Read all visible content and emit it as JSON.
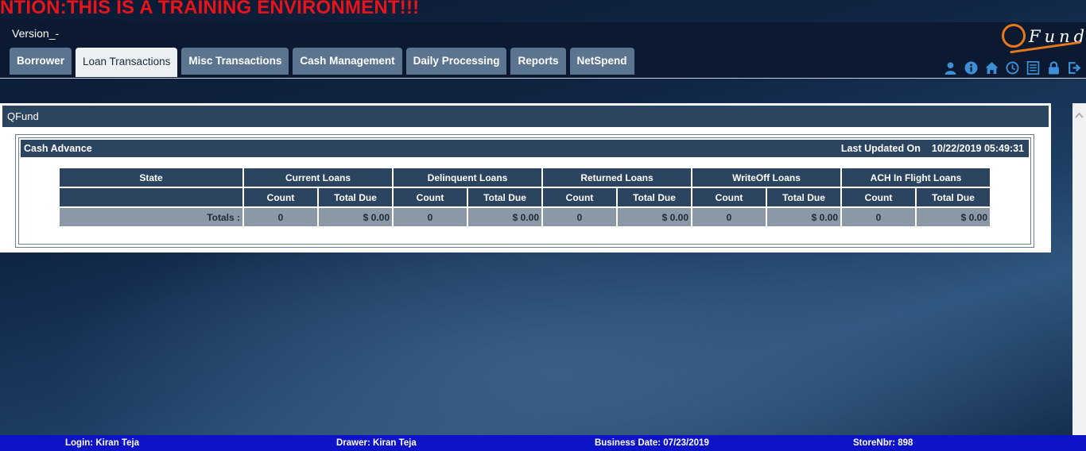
{
  "banner": "NTION:THIS IS A TRAINING ENVIRONMENT!!!",
  "header": {
    "version": "Version_-",
    "logo": {
      "text": "Fund",
      "accent": "#e8781c"
    },
    "tabs": [
      {
        "label": "Borrower",
        "active": false
      },
      {
        "label": "Loan Transactions",
        "active": true
      },
      {
        "label": "Misc Transactions",
        "active": false
      },
      {
        "label": "Cash Management",
        "active": false
      },
      {
        "label": "Daily Processing",
        "active": false
      },
      {
        "label": "Reports",
        "active": false
      },
      {
        "label": "NetSpend",
        "active": false
      }
    ],
    "icons": [
      "user-icon",
      "info-icon",
      "home-icon",
      "clock-icon",
      "list-icon",
      "lock-icon",
      "logout-icon"
    ]
  },
  "panel": {
    "title": "QFund",
    "section": {
      "title": "Cash Advance",
      "last_updated_label": "Last Updated On",
      "last_updated_value": "10/22/2019 05:49:31"
    },
    "table": {
      "state_header": "State",
      "groups": [
        "Current Loans",
        "Delinquent Loans",
        "Returned Loans",
        "WriteOff Loans",
        "ACH In Flight Loans"
      ],
      "sub_headers": [
        "Count",
        "Total Due"
      ],
      "totals_label": "Totals :",
      "totals": [
        {
          "count": "0",
          "total_due": "$ 0.00"
        },
        {
          "count": "0",
          "total_due": "$ 0.00"
        },
        {
          "count": "0",
          "total_due": "$ 0.00"
        },
        {
          "count": "0",
          "total_due": "$ 0.00"
        },
        {
          "count": "0",
          "total_due": "$ 0.00"
        }
      ]
    }
  },
  "footer": {
    "login": "Login: Kiran Teja",
    "drawer": "Drawer: Kiran Teja",
    "business_date": "Business Date: 07/23/2019",
    "store": "StoreNbr: 898"
  },
  "colors": {
    "banner": "#e8141a",
    "header_bg": "#0b1a30",
    "tab_bg": "#5b7590",
    "table_header": "#2b4560",
    "footer_bg": "#0d14c8",
    "icon": "#3d8fd8"
  }
}
